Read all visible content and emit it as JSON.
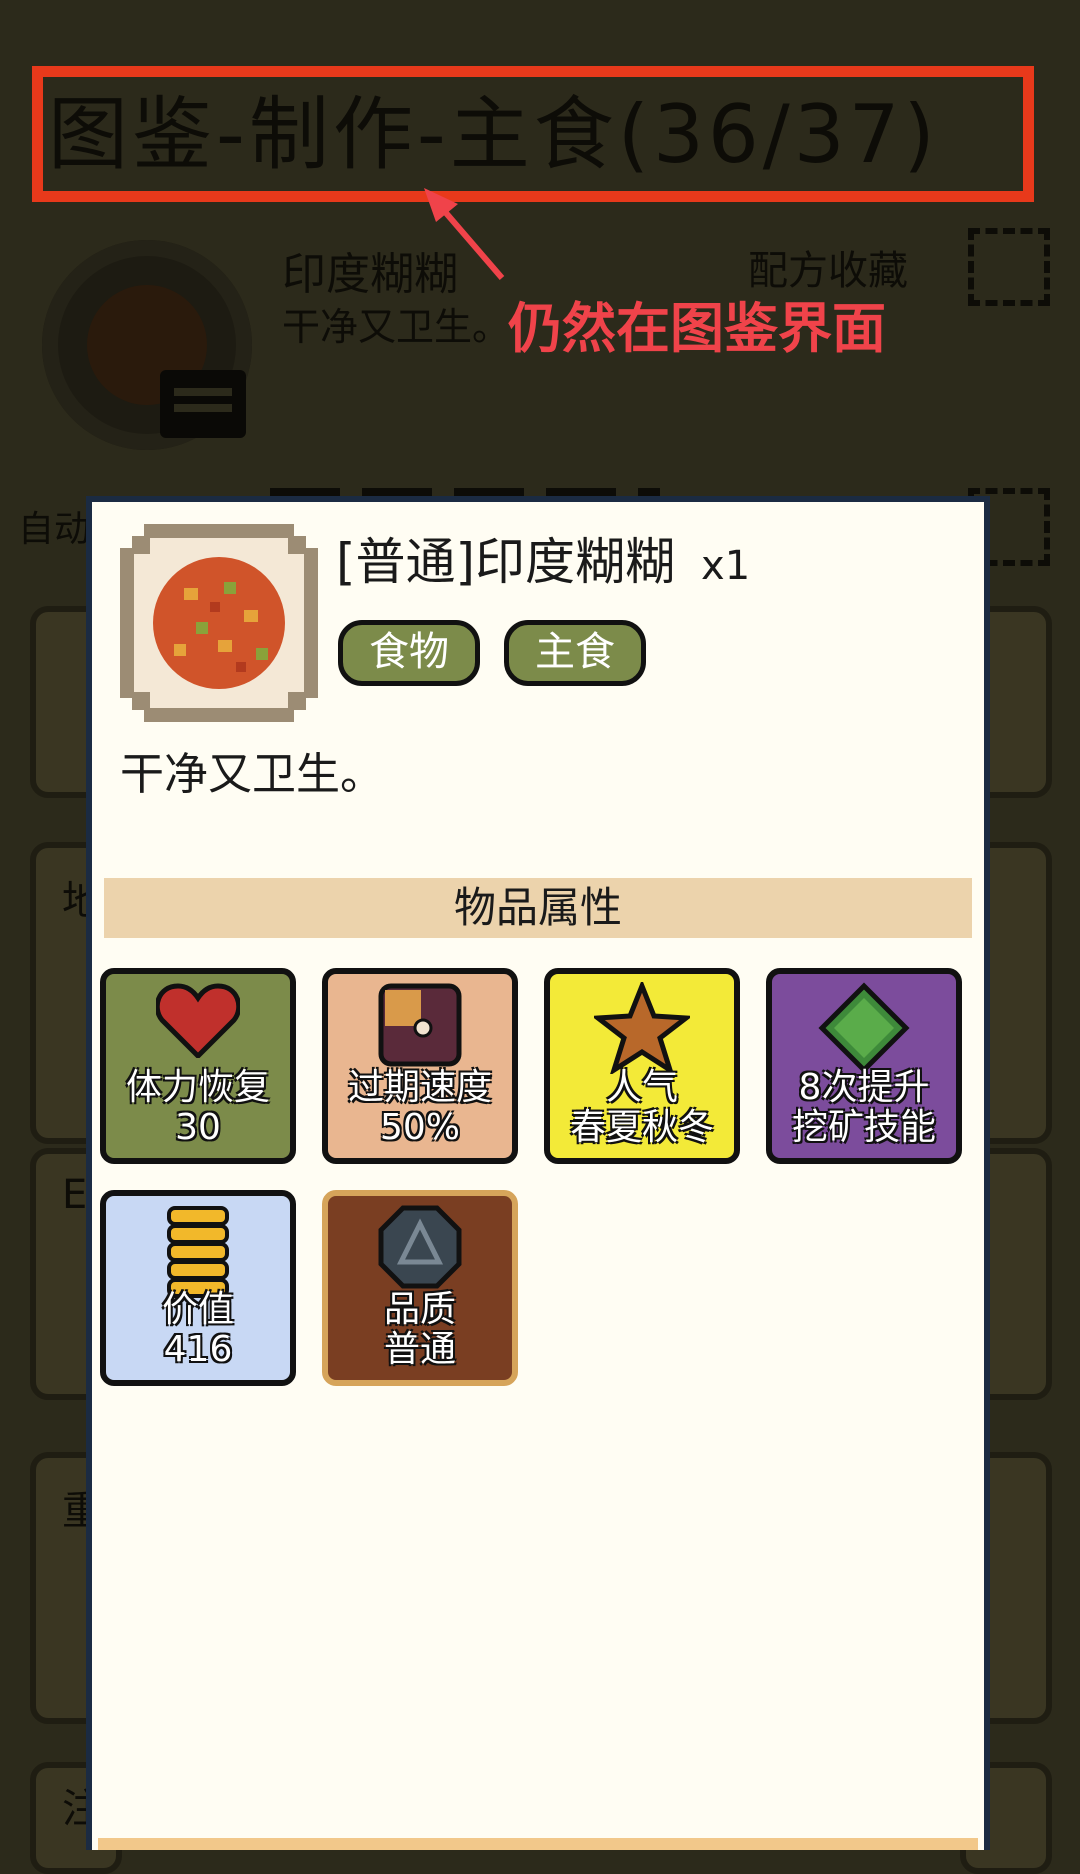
{
  "background": {
    "page_title": "图鉴-制作-主食(36/37)",
    "item_name": "印度糊糊",
    "item_desc": "干净又卫生。",
    "favorite_label": "配方收藏",
    "auto_label": "自动",
    "left_column_letters": [
      "地",
      "E",
      "重",
      "注"
    ]
  },
  "annotation": {
    "text": "仍然在图鉴界面",
    "color": "#f0434a",
    "highlight_color": "#e8391b"
  },
  "modal": {
    "title": "[普通]印度糊糊",
    "quantity": "x1",
    "tags": [
      "食物",
      "主食"
    ],
    "description": "干净又卫生。",
    "section_title": "物品属性",
    "attributes": [
      {
        "icon": "heart-icon",
        "line1": "体力恢复",
        "line2": "30",
        "bg": "#7c8b4a"
      },
      {
        "icon": "clock-icon",
        "line1": "过期速度",
        "line2": "50%",
        "bg": "#e9b690"
      },
      {
        "icon": "star-icon",
        "line1": "人气",
        "line2": "春夏秋冬",
        "bg": "#f3ea38"
      },
      {
        "icon": "gem-icon",
        "line1": "8次提升",
        "line2": "挖矿技能",
        "bg": "#7c4c9c"
      },
      {
        "icon": "coin-stack-icon",
        "line1": "价值",
        "line2": "416",
        "bg": "#c8d8f4"
      },
      {
        "icon": "quality-badge-icon",
        "line1": "品质",
        "line2": "普通",
        "bg": "#7a3e22"
      }
    ]
  }
}
